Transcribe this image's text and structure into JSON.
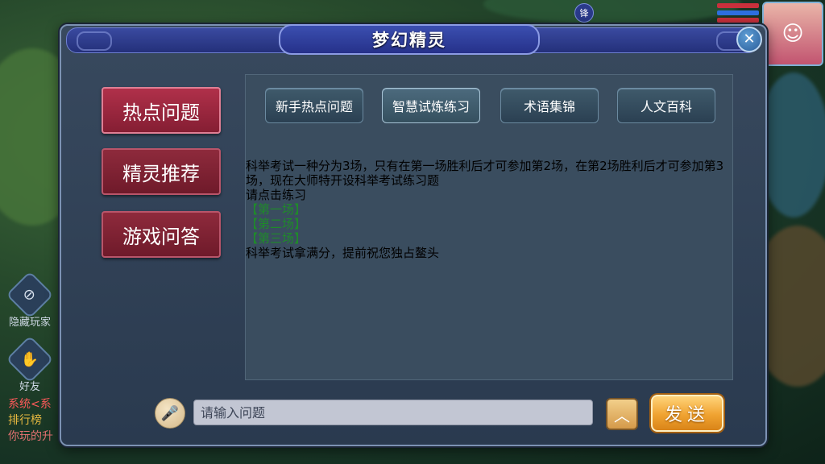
{
  "hud": {
    "top_badge": "锋",
    "side_hide": "隐藏玩家",
    "side_friend": "好友",
    "chat_lines": [
      {
        "text": "系统<系",
        "color": "#ff5a5a"
      },
      {
        "text": "排行榜",
        "color": "#e6b840"
      },
      {
        "text": "你玩的升",
        "color": "#e07070"
      }
    ]
  },
  "dialog": {
    "title": "梦幻精灵",
    "close_symbol": "✕"
  },
  "categories": [
    {
      "label": "热点问题",
      "active": true
    },
    {
      "label": "精灵推荐",
      "active": false
    },
    {
      "label": "游戏问答",
      "active": false
    }
  ],
  "tabs": [
    {
      "label": "新手热点问题"
    },
    {
      "label": "智慧试炼练习"
    },
    {
      "label": "术语集锦"
    },
    {
      "label": "人文百科"
    }
  ],
  "content": {
    "paragraph": "科举考试一种分为3场，只有在第一场胜利后才可参加第2场，在第2场胜利后才可参加第3场，现在大师特开设科举考试练习题",
    "prompt": "请点击练习",
    "links": [
      "【第一场】",
      "【第二场】",
      "【第三场】"
    ],
    "closing": "科举考试拿满分，提前祝您独占鳌头"
  },
  "input": {
    "placeholder": "请输入问题"
  },
  "buttons": {
    "send": "发送",
    "expand_symbol": "︿",
    "mic_symbol": "🎤"
  }
}
